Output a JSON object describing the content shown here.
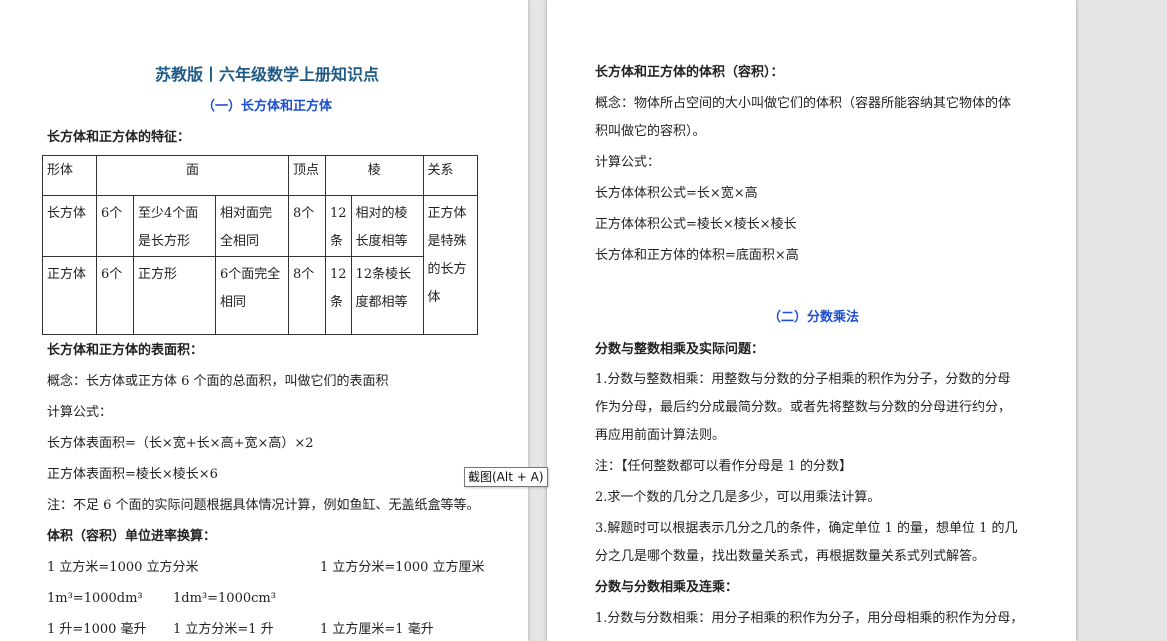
{
  "left": {
    "title": "苏教版丨六年级数学上册知识点",
    "section1": "（一）长方体和正方体",
    "features_heading": "长方体和正方体的特征：",
    "table": {
      "headers": [
        "形体",
        "面",
        "顶点",
        "棱",
        "关系"
      ],
      "rows": [
        [
          "长方体",
          "6个",
          "至少4个面是长方形",
          "相对面完全相同",
          "8个",
          "12条",
          "相对的棱长度相等"
        ],
        [
          "正方体",
          "6个",
          "正方形",
          "6个面完全相同",
          "8个",
          "12条",
          "12条棱长度都相等"
        ]
      ],
      "relation": "正方体是特殊的长方体"
    },
    "surface_heading": "长方体和正方体的表面积：",
    "surface_concept": "概念：长方体或正方体 6 个面的总面积，叫做它们的表面积",
    "formula_label": "计算公式：",
    "cuboid_surface": "长方体表面积=（长×宽+长×高+宽×高）×2",
    "cube_surface": "正方体表面积=棱长×棱长×6",
    "surface_note": "注：不足 6 个面的实际问题根据具体情况计算，例如鱼缸、无盖纸盒等等。",
    "units_heading": "体积（容积）单位进率换算：",
    "unit_line1_a": "1 立方米=1000 立方分米",
    "unit_line1_b": "1 立方分米=1000 立方厘米",
    "unit_line2_a": "1m³=1000dm³",
    "unit_line2_b": "1dm³=1000cm³",
    "unit_line3_a": "1 升=1000 毫升",
    "unit_line3_b": "1 立方分米=1 升",
    "unit_line3_c": "1 立方厘米=1 毫升"
  },
  "tooltip": "截图(Alt + A)",
  "right": {
    "volume_heading": "长方体和正方体的体积（容积）：",
    "volume_concept_1": "概念：物体所占空间的大小叫做它们的体积（容器所能容纳其它物体的体",
    "volume_concept_2": "积叫做它的容积）。",
    "formula_label": "计算公式：",
    "cuboid_volume": "长方体体积公式=长×宽×高",
    "cube_volume": "正方体体积公式=棱长×棱长×棱长",
    "general_volume": "长方体和正方体的体积=底面积×高",
    "section2": "（二）分数乘法",
    "frac_int_heading": "分数与整数相乘及实际问题：",
    "p1_1": "1.分数与整数相乘：用整数与分数的分子相乘的积作为分子，分数的分母",
    "p1_2": "作为分母，最后约分成最简分数。或者先将整数与分数的分母进行约分，",
    "p1_3": "再应用前面计算法则。",
    "note": "注：【任何整数都可以看作分母是 1 的分数】",
    "p2": "2.求一个数的几分之几是多少，可以用乘法计算。",
    "p3_1": "3.解题时可以根据表示几分之几的条件，确定单位 1 的量，想单位 1 的几",
    "p3_2": "分之几是哪个数量，找出数量关系式，再根据数量关系式列式解答。",
    "frac_frac_heading": "分数与分数相乘及连乘：",
    "p4": "1.分数与分数相乘：用分子相乘的积作为分子，用分母相乘的积作为分母，"
  }
}
